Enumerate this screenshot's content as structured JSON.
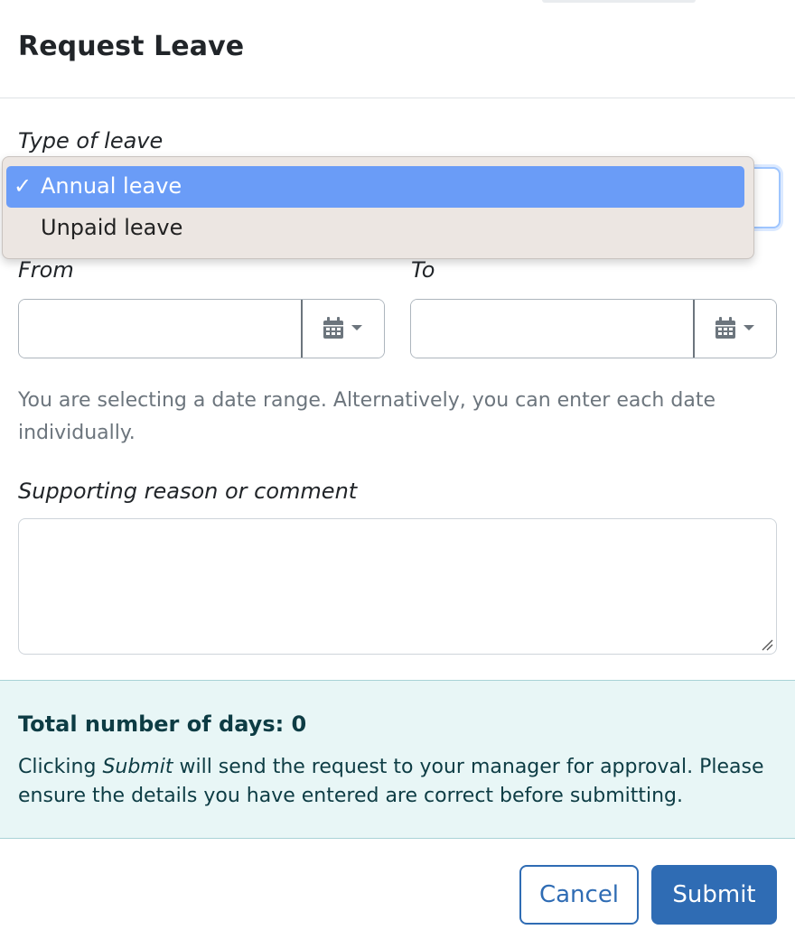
{
  "modal": {
    "title": "Request Leave"
  },
  "leave_type": {
    "label": "Type of leave",
    "options": [
      {
        "label": "Annual leave",
        "selected": true,
        "check": "✓"
      },
      {
        "label": "Unpaid leave",
        "selected": false,
        "check": ""
      }
    ]
  },
  "dates": {
    "from_label": "From",
    "to_label": "To",
    "from_value": "",
    "to_value": "",
    "calendar_icon": "calendar-icon",
    "caret_icon": "caret-down-icon",
    "help_text": "You are selecting a date range. Alternatively, you can enter each date individually."
  },
  "comment": {
    "label": "Supporting reason or comment",
    "value": ""
  },
  "summary": {
    "total_days": "Total number of days: 0",
    "note_prefix": "Clicking ",
    "note_emphasis": "Submit",
    "note_suffix": " will send the request to your manager for approval. Please ensure the details you have entered are correct before submitting."
  },
  "footer": {
    "cancel_label": "Cancel",
    "submit_label": "Submit"
  },
  "colors": {
    "primary": "#2f6cb4",
    "selected_option": "#6a9cf7",
    "info_background": "#e8f6f6"
  }
}
